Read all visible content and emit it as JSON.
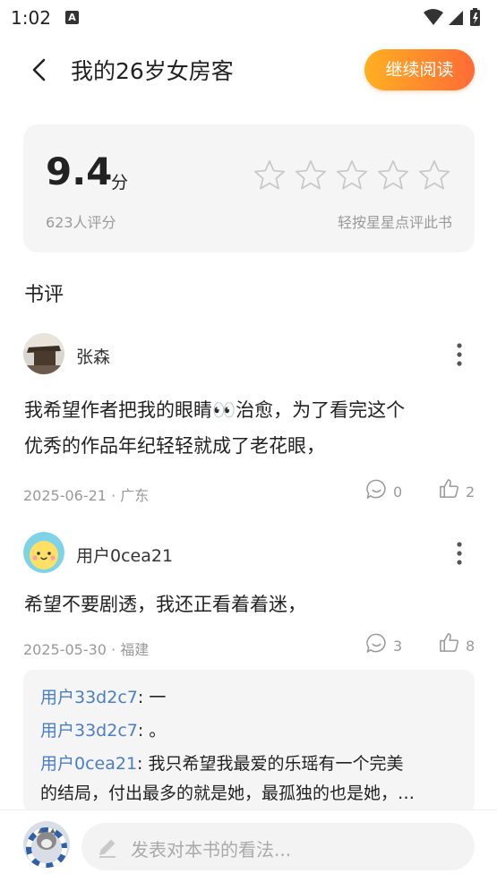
{
  "status": {
    "time": "1:02",
    "a_badge": "A"
  },
  "header": {
    "title": "我的26岁女房客",
    "continue_label": "继续阅读"
  },
  "rating": {
    "score": "9.4",
    "score_unit": "分",
    "count_text": "623人评分",
    "star_hint": "轻按星星点评此书",
    "star_total": 5,
    "star_filled": 0
  },
  "reviews": {
    "section_title": "书评",
    "items": [
      {
        "username": "张森",
        "text_line1": "我希望作者把我的眼睛👀治愈，为了看完这个",
        "text_line2": "优秀的作品年纪轻轻就成了老花眼，",
        "date_location": "2025-06-21 · 广东",
        "comment_count": "0",
        "like_count": "2"
      },
      {
        "username": "用户0cea21",
        "text_line1": "希望不要剧透，我还正看着着迷，",
        "date_location": "2025-05-30 · 福建",
        "comment_count": "3",
        "like_count": "8",
        "replies": [
          {
            "user": "用户33d2c7",
            "text": ": 一"
          },
          {
            "user": "用户33d2c7",
            "text": ": 。"
          },
          {
            "user": "用户0cea21",
            "text": ": 我只希望我最爱的乐瑶有一个完美",
            "cont": "的结局，付出最多的就是她，最孤独的也是她，…"
          }
        ]
      }
    ]
  },
  "bottom": {
    "placeholder": "发表对本书的看法..."
  },
  "colors": {
    "accent_start": "#ffb021",
    "accent_end": "#ff6b35",
    "link": "#4a7ec6"
  }
}
